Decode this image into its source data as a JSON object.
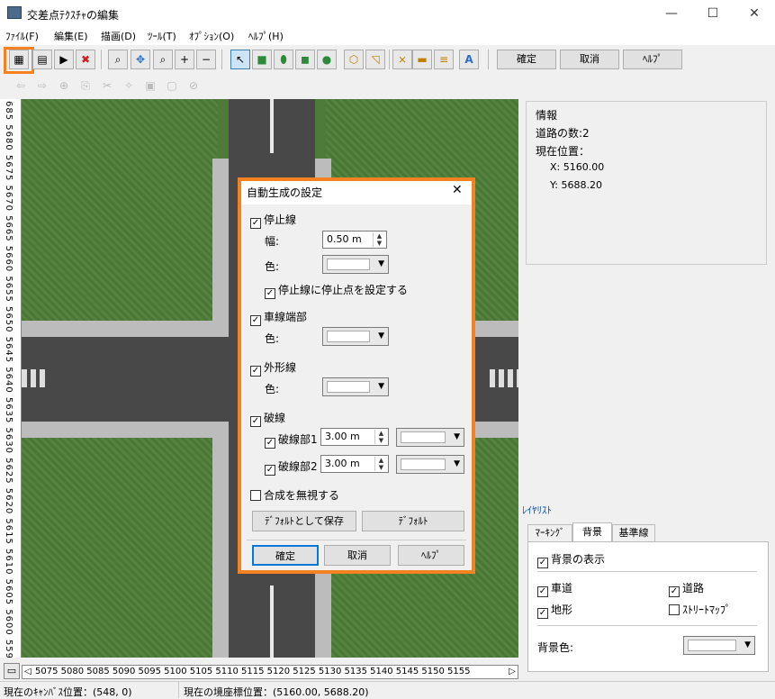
{
  "window": {
    "title": "交差点ﾃｸｽﾁｬの編集",
    "minimize": "—",
    "maximize": "☐",
    "close": "✕"
  },
  "menu": [
    "ﾌｧｲﾙ(F)",
    "編集(E)",
    "描画(D)",
    "ﾂｰﾙ(T)",
    "ｵﾌﾟｼｮﾝ(O)",
    "ﾍﾙﾌﾟ(H)"
  ],
  "toolbar": {
    "confirm": "確定",
    "cancel": "取消",
    "help": "ﾍﾙﾌﾟ"
  },
  "ruler": {
    "vertical": "685 5680 5675 5670 5665 5660 5655 5650 5645 5640 5635 5630 5625 5620 5615 5610 5605 5600 5595 559",
    "horizontal": "5075 5080 5085 5090 5095 5100 5105 5110 5115 5120 5125 5130 5135 5140 5145 5150 5155"
  },
  "info": {
    "title": "情報",
    "road_count": "道路の数:2",
    "position_label": "現在位置：",
    "x": "X: 5160.00",
    "y": "Y: 5688.20"
  },
  "layer": {
    "title": "ﾚｲﾔﾘｽﾄ",
    "tabs": [
      "ﾏｰｷﾝｸﾞ",
      "背景",
      "基準線"
    ],
    "show_bg": "背景の表示",
    "road": "車道",
    "street": "道路",
    "terrain": "地形",
    "streetmap": "ｽﾄﾘｰﾄﾏｯﾌﾟ",
    "bgcolor": "背景色:"
  },
  "dialog": {
    "title": "自動生成の設定",
    "stopline": "停止線",
    "width_label": "幅:",
    "width_value": "0.50 m",
    "color_label": "色:",
    "stop_point": "停止線に停止点を設定する",
    "lane_end": "車線端部",
    "outline": "外形線",
    "dashed": "破線",
    "dash1": "破線部1",
    "dash1_value": "3.00 m",
    "dash2": "破線部2",
    "dash2_value": "3.00 m",
    "ignore_merge": "合成を無視する",
    "save_default": "ﾃﾞﾌｫﾙﾄとして保存",
    "default": "ﾃﾞﾌｫﾙﾄ",
    "ok": "確定",
    "cancel": "取消",
    "help": "ﾍﾙﾌﾟ"
  },
  "status": {
    "canvas_pos": "現在のｷｬﾝﾊﾞｽ位置：(548, 0)",
    "world_pos": "現在の境座標位置：(5160.00, 5688.20)"
  },
  "colors": {
    "highlight": "#f58220",
    "grass": "#4e7a3a",
    "road": "#484848"
  }
}
